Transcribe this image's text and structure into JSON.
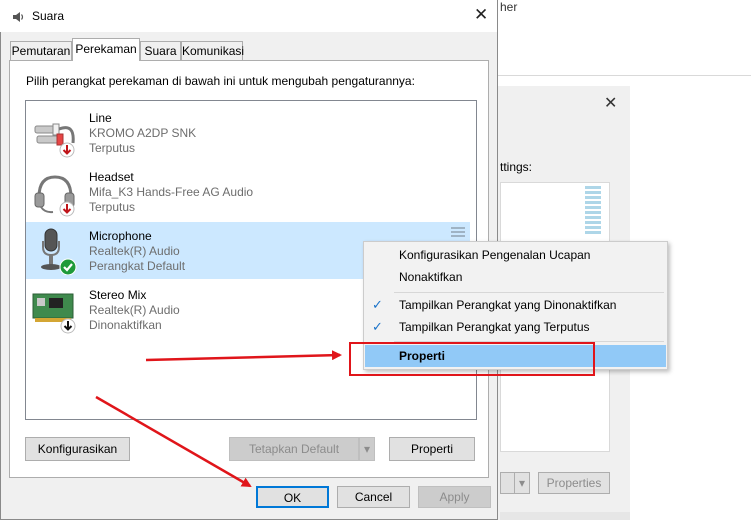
{
  "background": {
    "top_text": "her",
    "settings_label": "ttings:",
    "properties_label": "Properties"
  },
  "dialog": {
    "title": "Suara",
    "close_glyph": "✕",
    "tabs": [
      {
        "label": "Pemutaran",
        "active": false
      },
      {
        "label": "Perekaman",
        "active": true
      },
      {
        "label": "Suara",
        "active": false
      },
      {
        "label": "Komunikasi",
        "active": false
      }
    ],
    "instruction": "Pilih perangkat perekaman di bawah ini untuk mengubah pengaturannya:",
    "devices": [
      {
        "name": "Line",
        "driver": "KROMO A2DP SNK",
        "status": "Terputus",
        "icon": "line-jack-icon",
        "badge": "down-arrow-red"
      },
      {
        "name": "Headset",
        "driver": "Mifa_K3 Hands-Free AG Audio",
        "status": "Terputus",
        "icon": "headset-icon",
        "badge": "down-arrow-red"
      },
      {
        "name": "Microphone",
        "driver": "Realtek(R) Audio",
        "status": "Perangkat Default",
        "icon": "microphone-icon",
        "badge": "checkmark-green",
        "selected": true
      },
      {
        "name": "Stereo Mix",
        "driver": "Realtek(R) Audio",
        "status": "Dinonaktifkan",
        "icon": "sound-card-icon",
        "badge": "down-arrow-black"
      }
    ],
    "buttons": {
      "configure": "Konfigurasikan",
      "set_default": "Tetapkan Default",
      "properties": "Properti",
      "ok": "OK",
      "cancel": "Cancel",
      "apply": "Apply"
    }
  },
  "context_menu": {
    "items": [
      {
        "label": "Konfigurasikan Pengenalan Ucapan",
        "checked": false
      },
      {
        "label": "Nonaktifkan",
        "checked": false
      },
      {
        "label": "Tampilkan Perangkat yang Dinonaktifkan",
        "checked": true
      },
      {
        "label": "Tampilkan Perangkat yang Terputus",
        "checked": true
      },
      {
        "label": "Properti",
        "checked": false,
        "highlighted": true
      }
    ],
    "check_glyph": "✓"
  },
  "colors": {
    "selection": "#cce8ff",
    "menu_highlight": "#91c9f7",
    "annotation_red": "#e0151a",
    "accent_blue": "#0078d7"
  }
}
